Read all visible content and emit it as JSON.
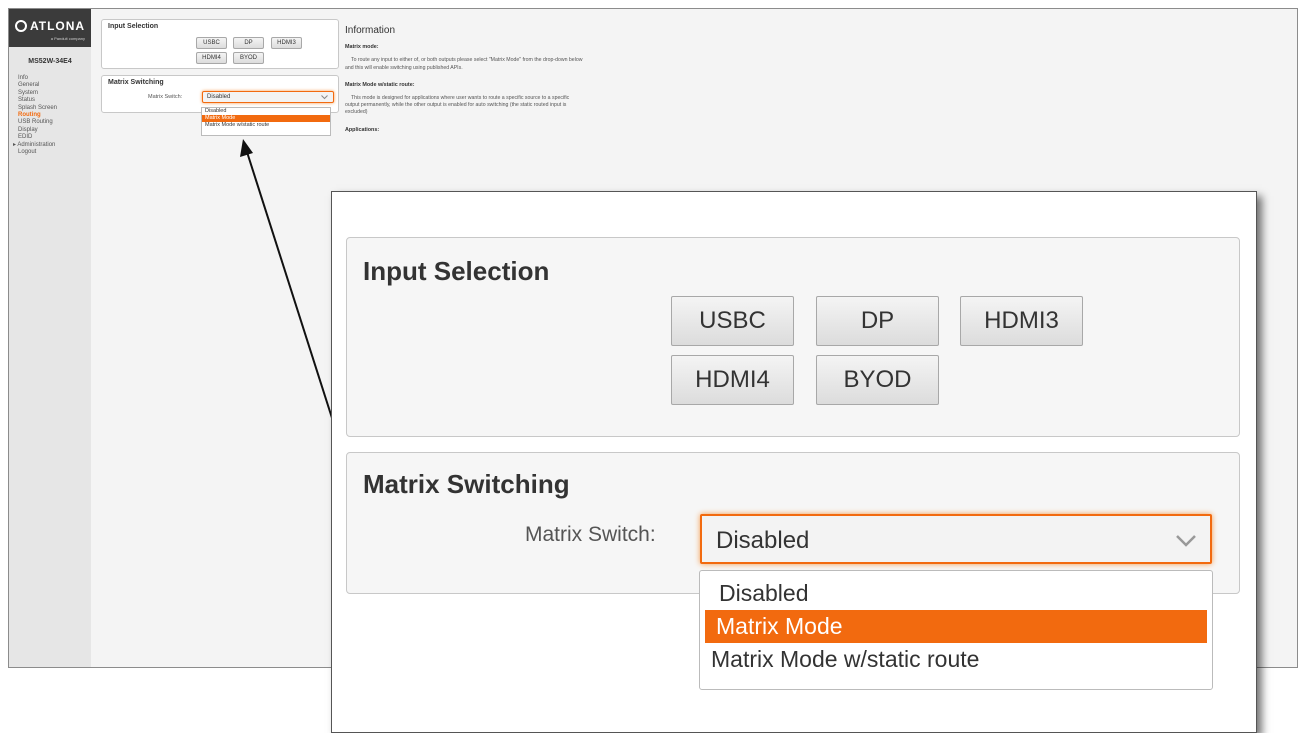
{
  "brand": {
    "name": "ATLONA",
    "tagline": "a Panduit company"
  },
  "device": {
    "name": "MS52W-34E4"
  },
  "nav": [
    {
      "label": "Info"
    },
    {
      "label": "General"
    },
    {
      "label": "System"
    },
    {
      "label": "Status"
    },
    {
      "label": "Splash Screen"
    },
    {
      "label": "Routing",
      "active": true
    },
    {
      "label": "USB Routing"
    },
    {
      "label": "Display"
    },
    {
      "label": "EDID"
    },
    {
      "label": "▸ Administration"
    },
    {
      "label": "Logout"
    }
  ],
  "input_selection": {
    "title": "Input Selection",
    "buttons": [
      "USBC",
      "DP",
      "HDMI3",
      "HDMI4",
      "BYOD"
    ]
  },
  "matrix_switching": {
    "title": "Matrix Switching",
    "label": "Matrix Switch:",
    "selected": "Disabled",
    "options": [
      "Disabled",
      "Matrix Mode",
      "Matrix Mode w/static route"
    ],
    "highlighted": "Matrix Mode"
  },
  "information": {
    "title": "Information",
    "matrix_mode_heading": "Matrix mode:",
    "matrix_mode_text": "To route any input to either of, or both outputs please select \"Matrix Mode\" from the drop-down below and this will enable switching using published APIs.",
    "static_heading": "Matrix Mode w/static route:",
    "static_text": "This mode is designed for applications where user wants to route a specific source to a specific output permanently, while the other output is enabled for auto switching (the static routed input is excluded)",
    "applications_heading": "Applications:"
  },
  "colors": {
    "accent": "#f26a0f",
    "sidebar": "#e6e6e6",
    "logo_bar": "#3b3b3b"
  },
  "icons": {
    "dropdown": "chevron-down-icon",
    "logo": "atlona-logo-icon",
    "callout": "callout-arrow"
  }
}
